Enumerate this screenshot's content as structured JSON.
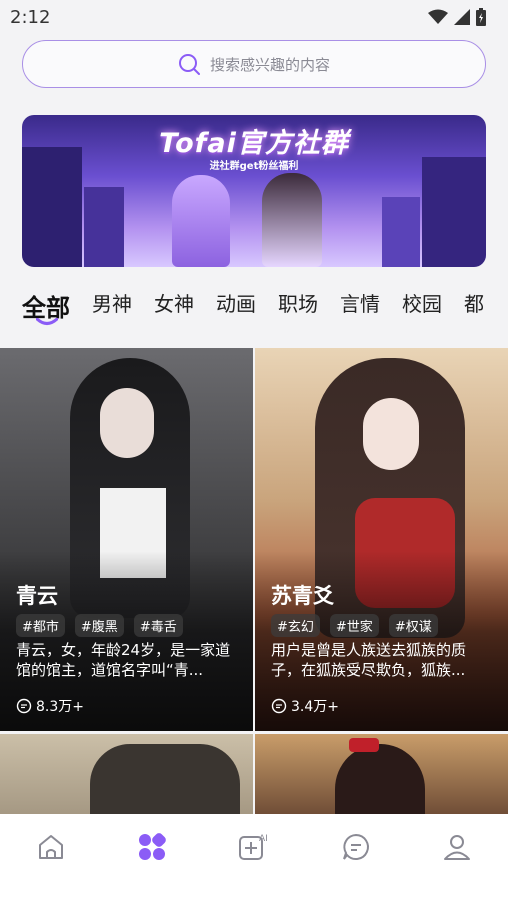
{
  "status": {
    "time": "2:12"
  },
  "search": {
    "placeholder": "搜索感兴趣的内容"
  },
  "banner": {
    "title": "Tofai官方社群",
    "subtitle": "进社群get粉丝福利"
  },
  "tabs": [
    "全部",
    "男神",
    "女神",
    "动画",
    "职场",
    "言情",
    "校园",
    "都"
  ],
  "cards": [
    {
      "name": "青云",
      "tags": [
        "#都市",
        "#腹黑",
        "#毒舌"
      ],
      "desc": "青云，女，年龄24岁，是一家道馆的馆主，道馆名字叫“青...",
      "count": "8.3万+"
    },
    {
      "name": "苏青爻",
      "tags": [
        "#玄幻",
        "#世家",
        "#权谋"
      ],
      "desc": "用户是曾是人族送去狐族的质子，在狐族受尽欺负，狐族...",
      "count": "3.4万+"
    }
  ],
  "nav": {
    "icons": [
      "home-icon",
      "discover-icon",
      "ai-create-icon",
      "chat-icon",
      "profile-icon"
    ],
    "active": "discover-icon",
    "accent": "#8b5cf6"
  }
}
